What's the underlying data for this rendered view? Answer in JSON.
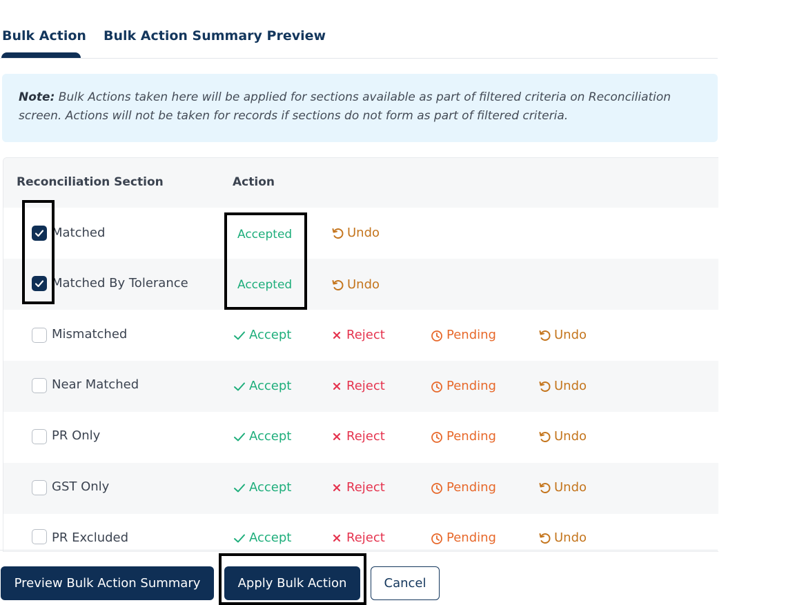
{
  "tabs": [
    {
      "label": "Bulk Action",
      "active": true
    },
    {
      "label": "Bulk Action Summary Preview",
      "active": false
    }
  ],
  "note": {
    "prefix": "Note:",
    "text": " Bulk Actions taken here will be applied for sections available as part of filtered criteria on Reconciliation screen. Actions will not be taken for records if sections do not form as part of filtered criteria."
  },
  "table": {
    "headers": [
      "Reconciliation Section",
      "Action"
    ],
    "rows": [
      {
        "label": "Matched",
        "checked": true,
        "status": "Accepted",
        "undo": "Undo"
      },
      {
        "label": "Matched By Tolerance",
        "checked": true,
        "status": "Accepted",
        "undo": "Undo"
      },
      {
        "label": "Mismatched",
        "checked": false,
        "accept": "Accept",
        "reject": "Reject",
        "pending": "Pending",
        "undo": "Undo"
      },
      {
        "label": "Near Matched",
        "checked": false,
        "accept": "Accept",
        "reject": "Reject",
        "pending": "Pending",
        "undo": "Undo"
      },
      {
        "label": "PR Only",
        "checked": false,
        "accept": "Accept",
        "reject": "Reject",
        "pending": "Pending",
        "undo": "Undo"
      },
      {
        "label": "GST Only",
        "checked": false,
        "accept": "Accept",
        "reject": "Reject",
        "pending": "Pending",
        "undo": "Undo"
      },
      {
        "label": "PR Excluded",
        "checked": false,
        "accept": "Accept",
        "reject": "Reject",
        "pending": "Pending",
        "undo": "Undo"
      }
    ]
  },
  "buttons": {
    "preview": "Preview Bulk Action Summary",
    "apply": "Apply Bulk Action",
    "cancel": "Cancel"
  },
  "colors": {
    "primary": "#0f2f55",
    "accept": "#1eae7b",
    "reject": "#e5334e",
    "pending": "#e7682a",
    "undo": "#c4751d",
    "note_bg": "#e7f5fd"
  },
  "icons": {
    "accept": "check-icon",
    "reject": "x-icon",
    "pending": "clock-icon",
    "undo": "undo-icon",
    "checkbox": "checkmark-icon"
  }
}
